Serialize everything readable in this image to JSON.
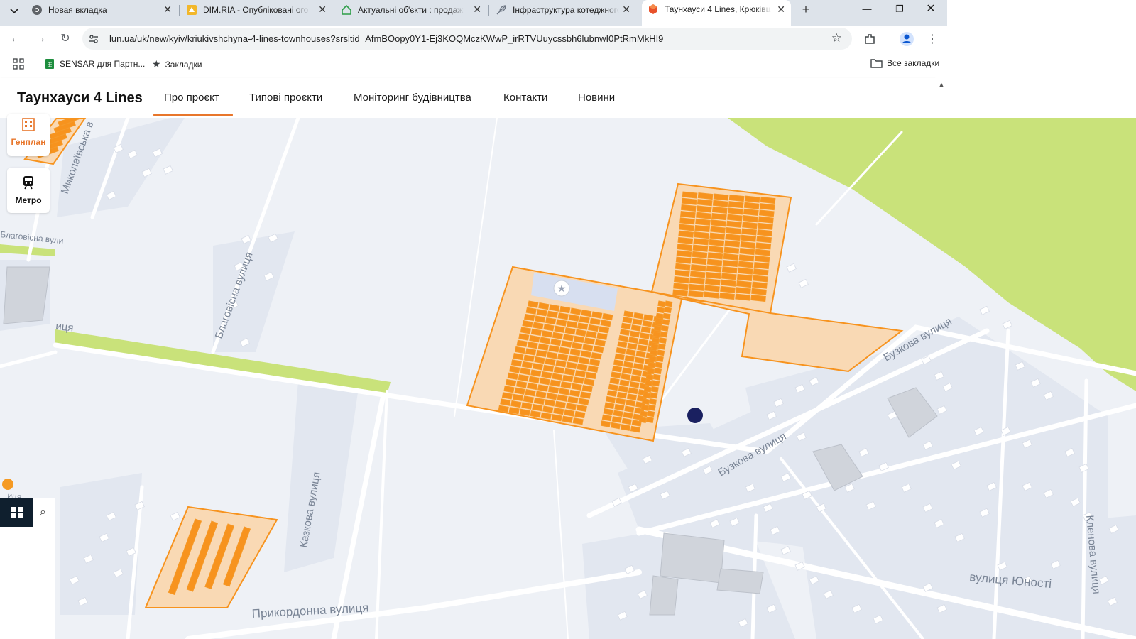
{
  "tabs": [
    {
      "title": "Новая вкладка",
      "icon": "chrome-icon"
    },
    {
      "title": "DIM.RIA - Опубліковані ого",
      "icon": "dimria-icon"
    },
    {
      "title": "Актуальні об'єкти : продаж",
      "icon": "house-icon"
    },
    {
      "title": "Інфраструктура котеджного",
      "icon": "feather-icon"
    },
    {
      "title": "Таунхауси 4 Lines, Крюківщ",
      "icon": "lun-icon",
      "active": true
    }
  ],
  "toolbar": {
    "url": "lun.ua/uk/new/kyiv/kriukivshchyna-4-lines-townhouses?srsltid=AfmBOopy0Y1-Ej3KOQMczKWwP_irRTVUuycssbh6lubnwI0PtRmMkHI9"
  },
  "bookmarks": {
    "sensar": "SENSAR для Партн...",
    "zakladky": "Закладки",
    "all": "Все закладки"
  },
  "site": {
    "title": "Таунхауси 4 Lines",
    "nav": [
      "Про проєкт",
      "Типові проєкти",
      "Моніторинг будівництва",
      "Контакти",
      "Новини"
    ]
  },
  "panel": {
    "genplan": "Генплан",
    "metro": "Метро"
  },
  "map": {
    "streets": {
      "mykolaivska": "Миколаївська в",
      "blagovisna1": "Благовісна вули",
      "blagovisna2": "Благовісна вулиця",
      "partial_left": "иця",
      "partial_left2": "иця",
      "kazkova": "Казкова вулиця",
      "prykordonna": "Прикордонна вулиця",
      "buzkova1": "Бузкова вулиця",
      "buzkova2": "Бузкова вулиця",
      "klenova": "Кленова вулиця",
      "yunosti": "вулиця Юності"
    },
    "colors": {
      "accent": "#f7931e",
      "plot_fill": "#f9d9b4",
      "park": "#c9e27a",
      "marker": "#1a2060"
    }
  }
}
